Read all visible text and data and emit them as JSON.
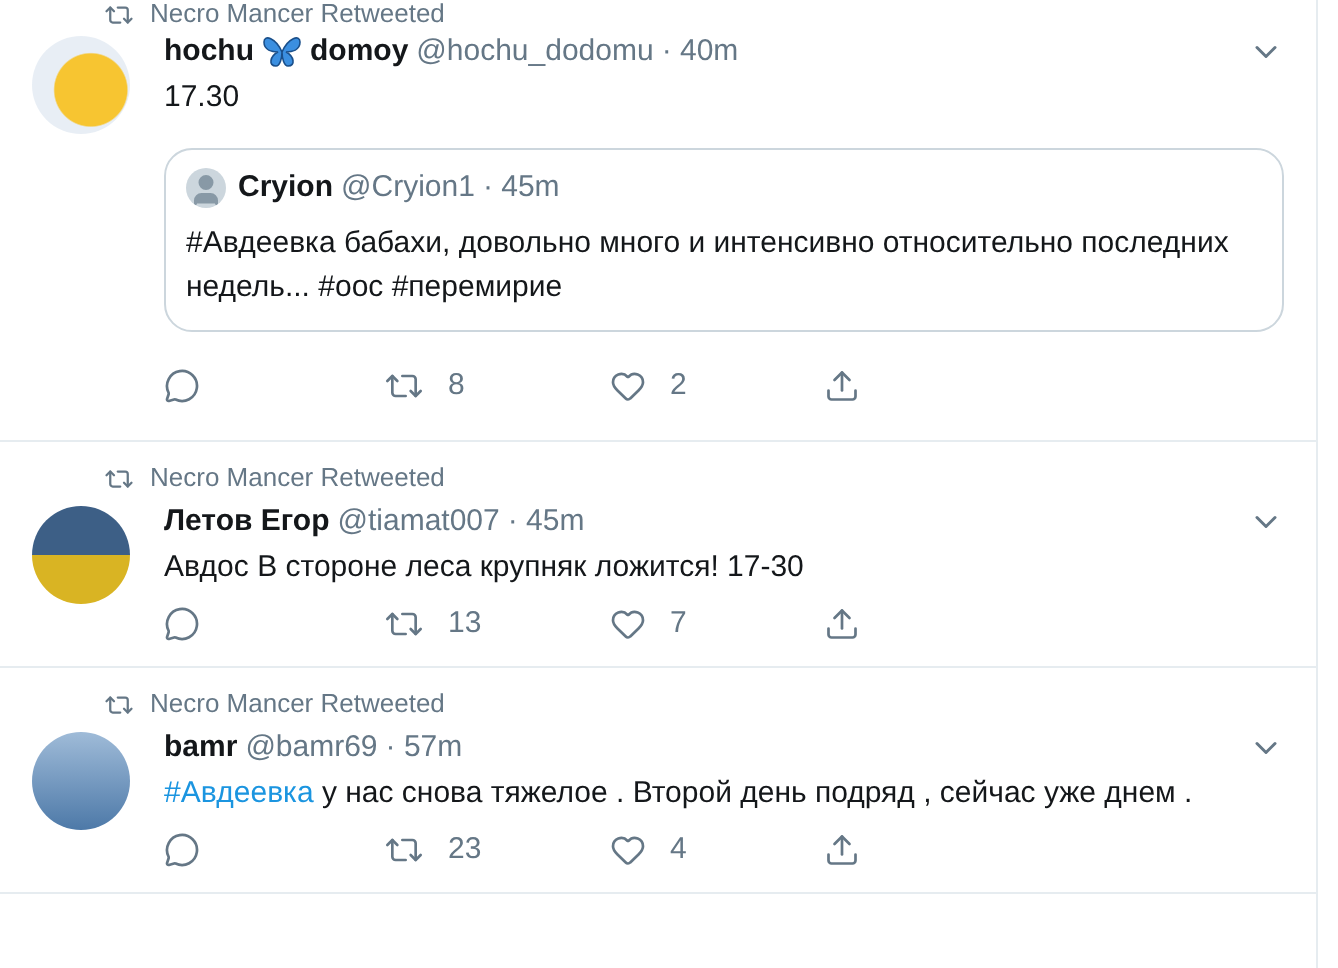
{
  "tweets": [
    {
      "retweeted_by": "Necro Mancer Retweeted",
      "name": [
        "hochu",
        "domoy"
      ],
      "handle": "@hochu_dodomu",
      "time": "· 40m",
      "text": [
        {
          "kind": "text",
          "s": "17.30"
        }
      ],
      "quote": {
        "name": "Cryion",
        "handle": "@Cryion1",
        "time": "· 45m",
        "text": "#Авдеевка бабахи, довольно много и интенсивно относительно последних недель... #оос #перемирие"
      },
      "retweets": "8",
      "likes": "2"
    },
    {
      "retweeted_by": "Necro Mancer Retweeted",
      "name": [
        "Летов Егор"
      ],
      "handle": "@tiamat007",
      "time": "· 45m",
      "text": [
        {
          "kind": "text",
          "s": "Авдос В стороне леса крупняк ложится! 17-30"
        }
      ],
      "retweets": "13",
      "likes": "7"
    },
    {
      "retweeted_by": "Necro Mancer Retweeted",
      "name": [
        "bamr"
      ],
      "handle": "@bamr69",
      "time": "· 57m",
      "text": [
        {
          "kind": "hashtag",
          "s": "#Авдеевка"
        },
        {
          "kind": "text",
          "s": " у нас снова тяжелое . Второй день подряд , сейчас уже днем ."
        }
      ],
      "retweets": "23",
      "likes": "4"
    }
  ]
}
